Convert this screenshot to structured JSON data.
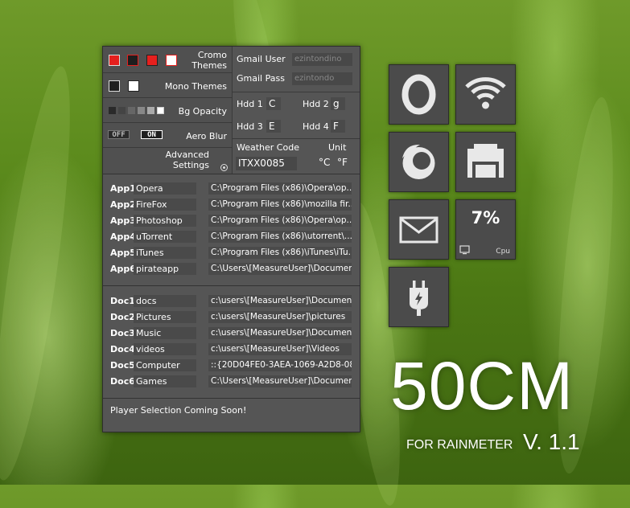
{
  "themes": {
    "cromo_label": "Cromo Themes",
    "cromo_swatches": [
      "#e6201e",
      "#1e1e1e",
      "#e6201e",
      "#ffffff"
    ],
    "mono_label": "Mono Themes",
    "mono_swatches": [
      "#1e1e1e",
      "#ffffff"
    ],
    "opacity_label": "Bg Opacity",
    "aero_label": "Aero Blur",
    "aero_off": "OFF",
    "aero_on": "ON",
    "advanced_label": "Advanced Settings"
  },
  "gmail": {
    "user_label": "Gmail User",
    "user_value": "ezintondino",
    "pass_label": "Gmail Pass",
    "pass_value": "ezintondo"
  },
  "hdd": [
    {
      "label": "Hdd 1",
      "value": "C"
    },
    {
      "label": "Hdd 2",
      "value": "g"
    },
    {
      "label": "Hdd 3",
      "value": "E"
    },
    {
      "label": "Hdd 4",
      "value": "F"
    }
  ],
  "weather": {
    "code_label": "Weather Code",
    "unit_label": "Unit",
    "code_value": "ITXX0085",
    "unit_c": "°C",
    "unit_f": "°F"
  },
  "apps": [
    {
      "key": "App1",
      "name": "Opera",
      "path": "C:\\Program Files (x86)\\Opera\\op..."
    },
    {
      "key": "App2",
      "name": "FireFox",
      "path": "C:\\Program Files (x86)\\mozilla fir..."
    },
    {
      "key": "App3",
      "name": "Photoshop",
      "path": "C:\\Program Files (x86)\\Opera\\op..."
    },
    {
      "key": "App4",
      "name": "uTorrent",
      "path": "C:\\Program Files (x86)\\utorrent\\..."
    },
    {
      "key": "App5",
      "name": "iTunes",
      "path": "C:\\Program Files (x86)\\iTunes\\iTu..."
    },
    {
      "key": "App6",
      "name": "pirateapp",
      "path": "C:\\Users\\[MeasureUser]\\Documen..."
    }
  ],
  "docs": [
    {
      "key": "Doc1",
      "name": "docs",
      "path": "c:\\users\\[MeasureUser]\\Documents"
    },
    {
      "key": "Doc2",
      "name": "Pictures",
      "path": "c:\\users\\[MeasureUser]\\pictures"
    },
    {
      "key": "Doc3",
      "name": "Music",
      "path": "c:\\users\\[MeasureUser]\\Documents"
    },
    {
      "key": "Doc4",
      "name": "videos",
      "path": "c:\\users\\[MeasureUser]\\Videos"
    },
    {
      "key": "Doc5",
      "name": "Computer",
      "path": "::{20D04FE0-3AEA-1069-A2D8-08..."
    },
    {
      "key": "Doc6",
      "name": "Games",
      "path": "C:\\Users\\[MeasureUser]\\Documen..."
    }
  ],
  "footer": {
    "player_text": "Player Selection Coming Soon!"
  },
  "tiles": {
    "icons": [
      "opera-icon",
      "wifi-icon",
      "firefox-icon",
      "explorer-folder-icon",
      "mail-icon",
      "cpu-meter",
      "power-plug-icon"
    ],
    "cpu_value": "7%",
    "cpu_label": "Cpu"
  },
  "brand": {
    "title": "50CM",
    "subtitle": "FOR RAINMETER",
    "version": "V. 1.1"
  }
}
